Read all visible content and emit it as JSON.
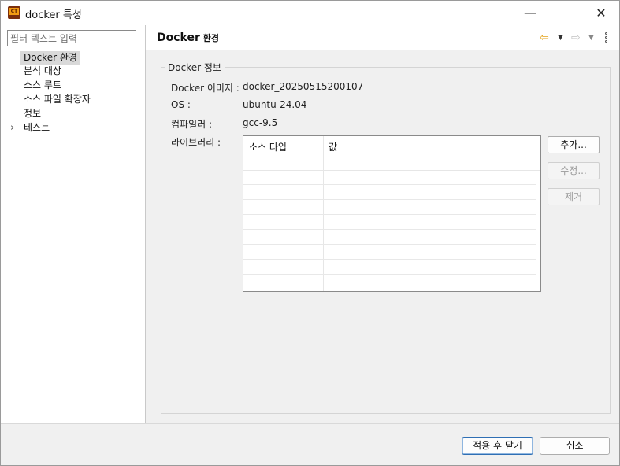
{
  "window": {
    "title": "docker 특성",
    "app_icon_text": "CT",
    "controls": {
      "minimize": "—",
      "maximize": "□",
      "close": "✕"
    }
  },
  "sidebar": {
    "filter_placeholder": "필터 텍스트 입력",
    "items": [
      {
        "label": "Docker 환경",
        "selected": true,
        "expandable": false
      },
      {
        "label": "분석 대상",
        "selected": false,
        "expandable": false
      },
      {
        "label": "소스 루트",
        "selected": false,
        "expandable": false
      },
      {
        "label": "소스 파일 확장자",
        "selected": false,
        "expandable": false
      },
      {
        "label": "정보",
        "selected": false,
        "expandable": false
      },
      {
        "label": "테스트",
        "selected": false,
        "expandable": true
      }
    ],
    "expander_glyph": "›"
  },
  "header": {
    "title_main": "Docker",
    "title_sub": " 환경",
    "icons": [
      "back-arrow-icon",
      "dropdown-icon",
      "forward-arrow-icon",
      "dropdown-icon",
      "view-menu-icon"
    ]
  },
  "docker_info": {
    "group_title": "Docker 정보",
    "fields": [
      {
        "label": "Docker 이미지 :",
        "value": "docker_20250515200107"
      },
      {
        "label": "OS :",
        "value": "ubuntu-24.04"
      },
      {
        "label": "컴파일러 :",
        "value": "gcc-9.5"
      }
    ],
    "library_label": "라이브러리 :",
    "table": {
      "columns": [
        "소스 타입",
        "값"
      ],
      "rows": []
    },
    "buttons": {
      "add": "추가...",
      "edit": "수정...",
      "remove": "제거"
    }
  },
  "footer": {
    "apply_close": "적용 후 닫기",
    "cancel": "취소"
  },
  "colors": {
    "accent_back_arrow": "#e3a21a",
    "primary_button_border": "#2f6fb4",
    "selection": "#d9d9d9"
  }
}
